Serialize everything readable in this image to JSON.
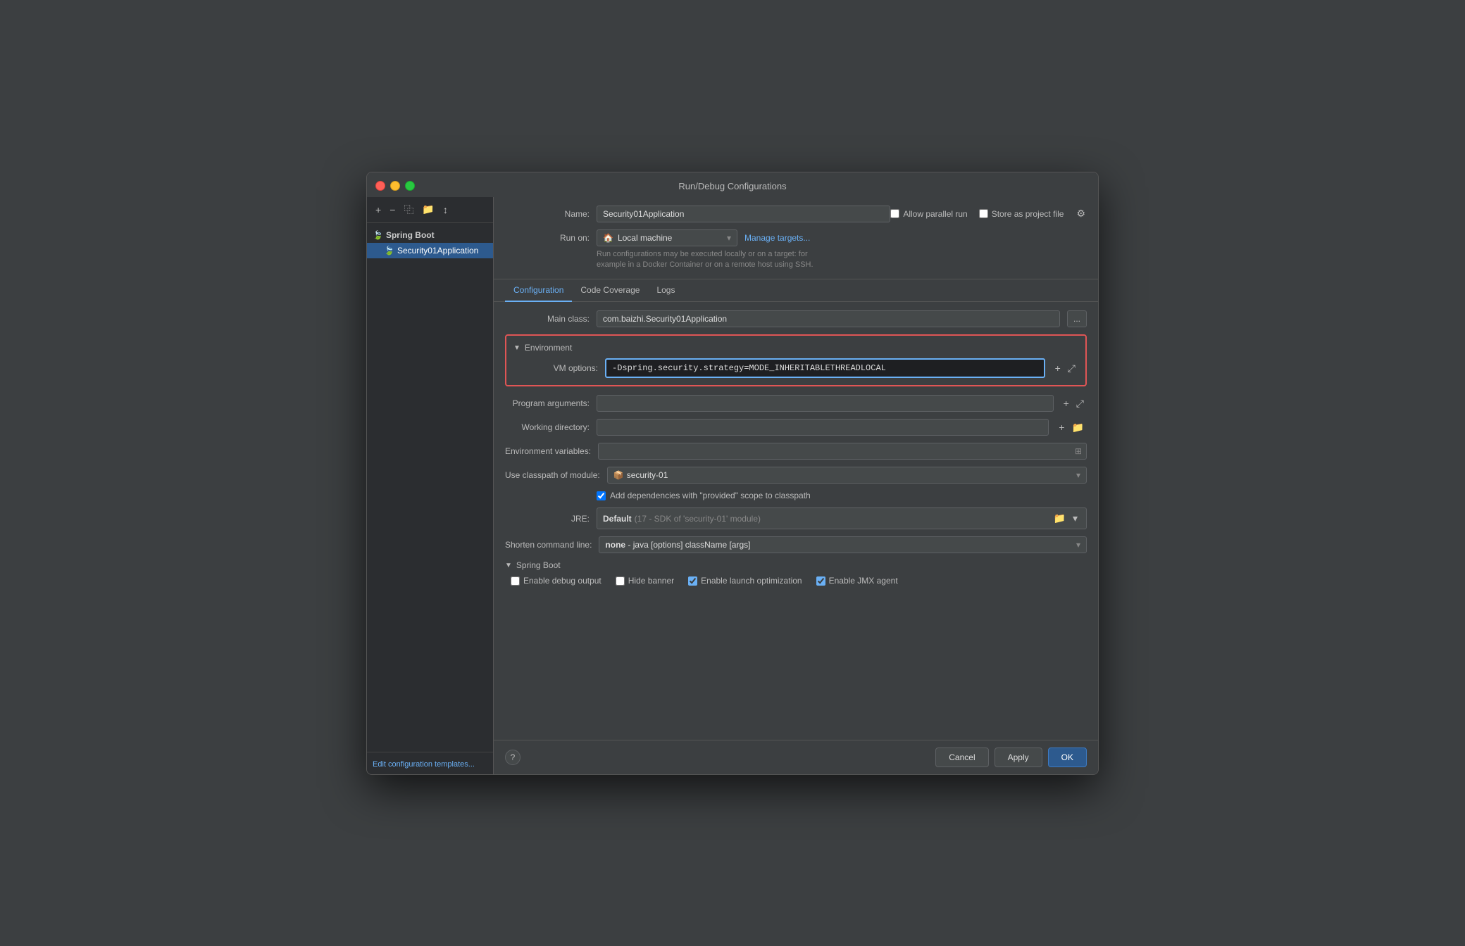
{
  "window": {
    "title": "Run/Debug Configurations"
  },
  "sidebar": {
    "toolbar_buttons": [
      "+",
      "−",
      "⿻",
      "📁",
      "↕"
    ],
    "tree": {
      "group_label": "Spring Boot",
      "child_label": "Security01Application"
    },
    "footer_link": "Edit configuration templates..."
  },
  "header": {
    "name_label": "Name:",
    "name_value": "Security01Application",
    "allow_parallel_label": "Allow parallel run",
    "store_as_project_label": "Store as project file"
  },
  "run_on": {
    "label": "Run on:",
    "value": "Local machine",
    "manage_link": "Manage targets...",
    "hint": "Run configurations may be executed locally or on a target: for\nexample in a Docker Container or on a remote host using SSH."
  },
  "tabs": [
    "Configuration",
    "Code Coverage",
    "Logs"
  ],
  "active_tab": "Configuration",
  "config": {
    "main_class_label": "Main class:",
    "main_class_value": "com.baizhi.Security01Application",
    "environment_section": {
      "title": "Environment",
      "vm_options_label": "VM options:",
      "vm_options_value": "-Dspring.security.strategy=MODE_INHERITABLETHREADLOCAL"
    },
    "program_args_label": "Program arguments:",
    "working_dir_label": "Working directory:",
    "env_vars_label": "Environment variables:",
    "classpath_label": "Use classpath of module:",
    "classpath_value": "security-01",
    "add_deps_label": "Add dependencies with \"provided\" scope to classpath",
    "jre_label": "JRE:",
    "jre_default": "Default",
    "jre_detail": "(17 - SDK of 'security-01' module)",
    "shorten_label": "Shorten command line:",
    "shorten_value": "none",
    "shorten_detail": "- java [options] className [args]",
    "spring_boot": {
      "title": "Spring Boot",
      "enable_debug_label": "Enable debug output",
      "hide_banner_label": "Hide banner",
      "enable_launch_label": "Enable launch optimization",
      "enable_jmx_label": "Enable JMX agent",
      "enable_launch_checked": true,
      "enable_jmx_checked": true,
      "enable_debug_checked": false,
      "hide_banner_checked": false
    }
  },
  "footer": {
    "cancel_label": "Cancel",
    "apply_label": "Apply",
    "ok_label": "OK"
  }
}
